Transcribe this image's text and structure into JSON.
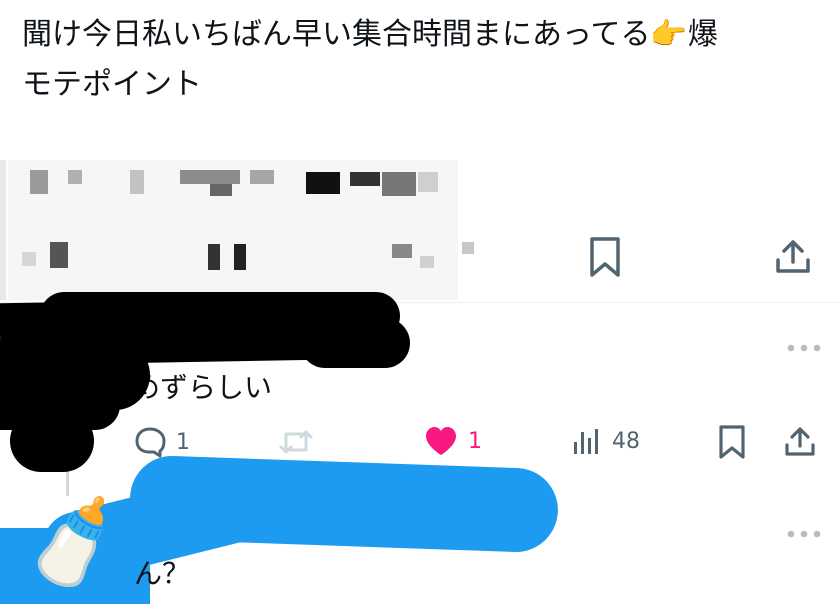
{
  "main_tweet": {
    "text_line1": "聞け今日私いちばん早い集合時間まにあってる",
    "emoji_point": "👈",
    "text_line1_end": "爆",
    "text_line2": "モテポイント"
  },
  "reply1": {
    "text": "めずらしい",
    "reply_count": "1",
    "like_count": "1",
    "views_count": "48"
  },
  "reply2": {
    "text": "ん？",
    "avatar_emoji": "🍼"
  },
  "colors": {
    "like_active": "#f91880",
    "icon_gray": "#536471",
    "scribble_blue": "#1d9bf0"
  },
  "icons": {
    "more": "more-horizontal-icon",
    "reply": "speech-bubble-icon",
    "retweet": "retweet-icon",
    "like": "heart-filled-icon",
    "views": "bar-chart-icon",
    "bookmark": "bookmark-icon",
    "share": "share-upload-icon"
  }
}
